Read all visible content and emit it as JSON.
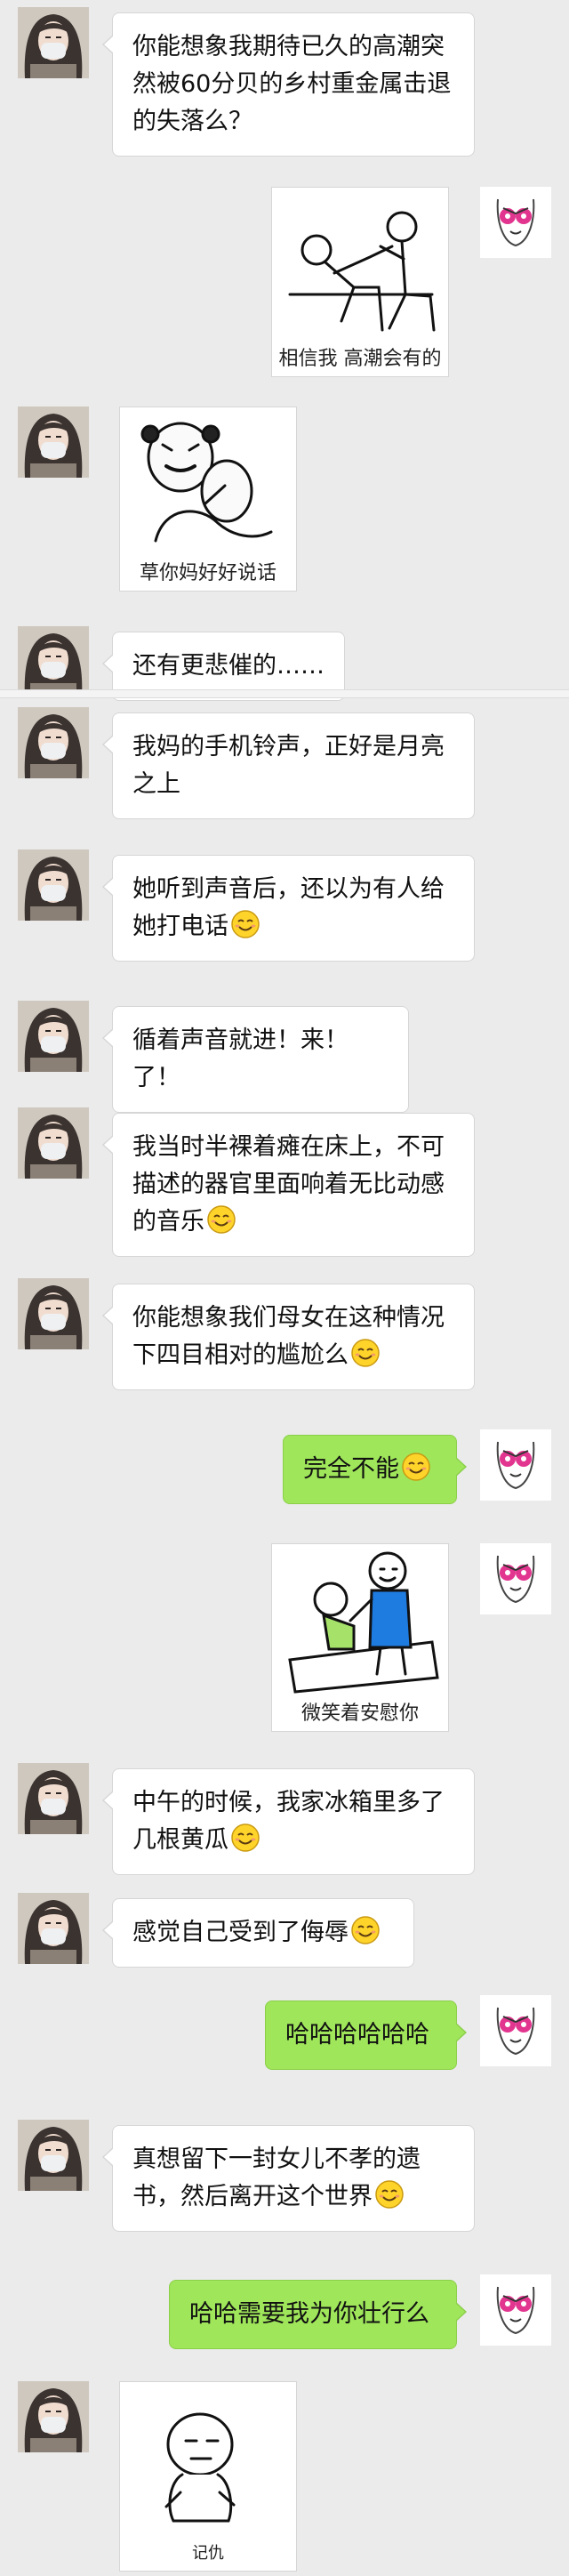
{
  "colors": {
    "background": "#ebebeb",
    "sent_bubble": "#9fe65a",
    "received_bubble": "#ffffff",
    "emoji_yellow": "#ffd42a"
  },
  "messages": [
    {
      "side": "left",
      "kind": "text",
      "lines": [
        "你能想象我期待已久的高潮突",
        "然被60分贝的乡村重金属击退",
        "的失落么？"
      ]
    },
    {
      "side": "right",
      "kind": "sticker",
      "sticker": "two-stick-figures-meme",
      "caption": "相信我  高潮会有的"
    },
    {
      "side": "left",
      "kind": "sticker",
      "sticker": "panda-face-meme",
      "caption": "草你妈好好说话"
    },
    {
      "side": "left",
      "kind": "text",
      "lines": [
        "还有更悲催的……"
      ]
    },
    {
      "side": "left",
      "kind": "text",
      "lines": [
        "我妈的手机铃声，正好是月亮",
        "之上"
      ]
    },
    {
      "side": "left",
      "kind": "text",
      "lines": [
        "她听到声音后，还以为有人给",
        "她打电话"
      ],
      "emoji": "smile-emoji"
    },
    {
      "side": "left",
      "kind": "text",
      "lines": [
        "循着声音就进！来！了！"
      ]
    },
    {
      "side": "left",
      "kind": "text",
      "lines": [
        "我当时半裸着瘫在床上，不可",
        "描述的器官里面响着无比动感",
        "的音乐"
      ],
      "emoji": "smile-emoji"
    },
    {
      "side": "left",
      "kind": "text",
      "lines": [
        "你能想象我们母女在这种情况",
        "下四目相对的尴尬么"
      ],
      "emoji": "smile-emoji"
    },
    {
      "side": "right",
      "kind": "text",
      "lines": [
        "完全不能"
      ],
      "emoji": "smile-emoji"
    },
    {
      "side": "right",
      "kind": "sticker",
      "sticker": "comforting-stick-figures-meme",
      "caption": "微笑着安慰你"
    },
    {
      "side": "left",
      "kind": "text",
      "lines": [
        "中午的时候，我家冰箱里多了",
        "几根黄瓜"
      ],
      "emoji": "smile-emoji"
    },
    {
      "side": "left",
      "kind": "text",
      "lines": [
        "感觉自己受到了侮辱"
      ],
      "emoji": "smile-emoji"
    },
    {
      "side": "right",
      "kind": "text",
      "lines": [
        "哈哈哈哈哈哈"
      ]
    },
    {
      "side": "left",
      "kind": "text",
      "lines": [
        "真想留下一封女儿不孝的遗",
        "书，然后离开这个世界"
      ],
      "emoji": "smile-emoji"
    },
    {
      "side": "right",
      "kind": "text",
      "lines": [
        "哈哈需要我为你壮行么"
      ]
    },
    {
      "side": "left",
      "kind": "sticker",
      "sticker": "grudge-face-meme",
      "caption": "记仇"
    }
  ]
}
